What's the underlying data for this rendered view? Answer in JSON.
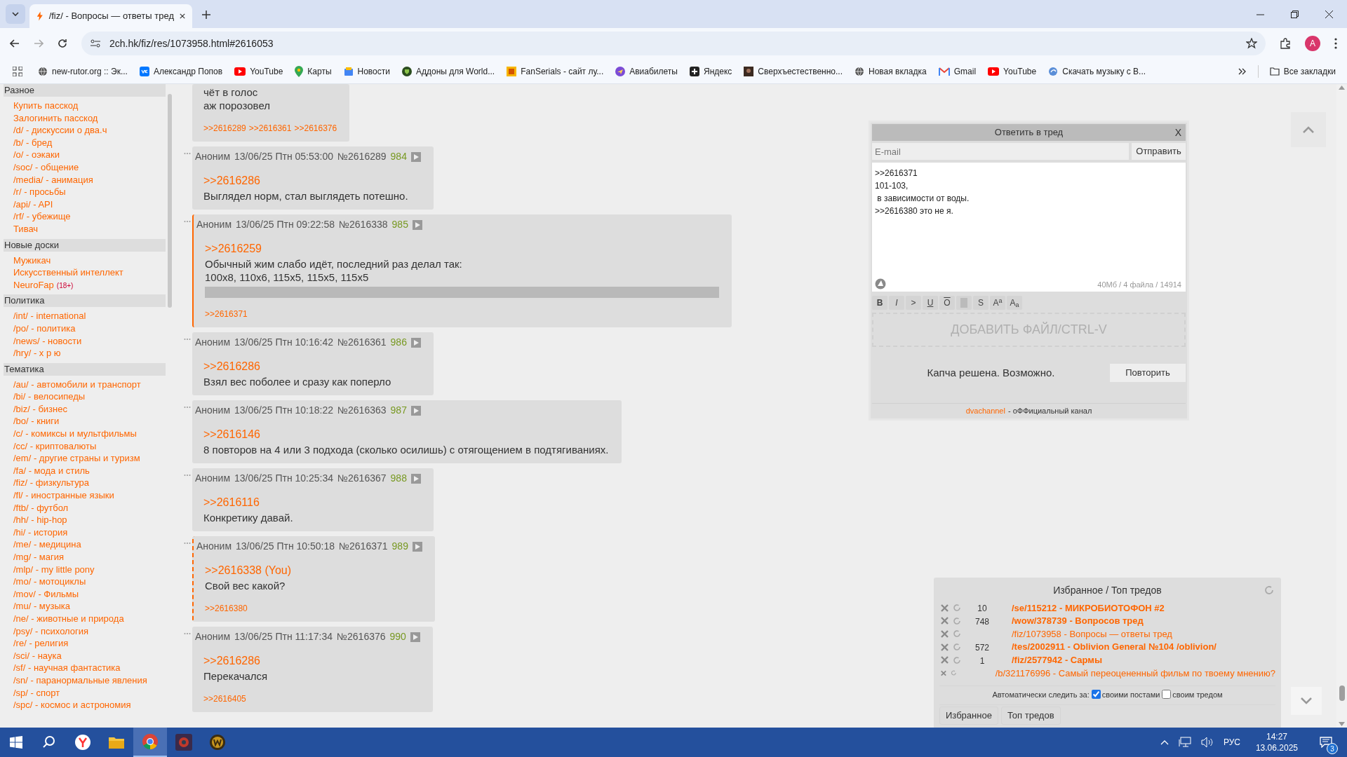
{
  "browser": {
    "tab_title": "/fiz/ - Вопросы — ответы тред",
    "url": "2ch.hk/fiz/res/1073958.html#2616053",
    "avatar": "A",
    "all_bookmarks": "Все закладки",
    "bookmarks": [
      {
        "label": "new-rutor.org :: Эк..."
      },
      {
        "label": "Александр Попов"
      },
      {
        "label": "YouTube"
      },
      {
        "label": "Карты"
      },
      {
        "label": "Новости"
      },
      {
        "label": "Аддоны для World..."
      },
      {
        "label": "FanSerials - сайт лу..."
      },
      {
        "label": "Авиабилеты"
      },
      {
        "label": "Яндекс"
      },
      {
        "label": "Сверхъестественно..."
      },
      {
        "label": "Новая вкладка"
      },
      {
        "label": "Gmail"
      },
      {
        "label": "YouTube"
      },
      {
        "label": "Скачать музыку с В..."
      }
    ]
  },
  "sidebar": {
    "sections": [
      {
        "heading": "Разное",
        "items": [
          {
            "label": "Купить пасскод"
          },
          {
            "label": "Залогинить пасскод"
          },
          {
            "label": "/d/ - дискуссии о два.ч"
          },
          {
            "label": "/b/ - бред"
          },
          {
            "label": "/o/ - оэкаки"
          },
          {
            "label": "/soc/ - общение"
          },
          {
            "label": "/media/ - анимация"
          },
          {
            "label": "/r/ - просьбы"
          },
          {
            "label": "/api/ - API"
          },
          {
            "label": "/rf/ - убежище"
          },
          {
            "label": "Тивач"
          }
        ]
      },
      {
        "heading": "Новые доски",
        "items": [
          {
            "label": "Мужикач"
          },
          {
            "label": "Искусственный интеллект"
          },
          {
            "label": "NeuroFap",
            "badge": "(18+)"
          }
        ]
      },
      {
        "heading": "Политика",
        "items": [
          {
            "label": "/int/ - international"
          },
          {
            "label": "/po/ - политика"
          },
          {
            "label": "/news/ - новости"
          },
          {
            "label": "/hry/ - х р ю"
          }
        ]
      },
      {
        "heading": "Тематика",
        "items": [
          {
            "label": "/au/ - автомобили и транспорт"
          },
          {
            "label": "/bi/ - велосипеды"
          },
          {
            "label": "/biz/ - бизнес"
          },
          {
            "label": "/bo/ - книги"
          },
          {
            "label": "/c/ - комиксы и мультфильмы"
          },
          {
            "label": "/cc/ - криптовалюты"
          },
          {
            "label": "/em/ - другие страны и туризм"
          },
          {
            "label": "/fa/ - мода и стиль"
          },
          {
            "label": "/fiz/ - физкультура"
          },
          {
            "label": "/fl/ - иностранные языки"
          },
          {
            "label": "/ftb/ - футбол"
          },
          {
            "label": "/hh/ - hip-hop"
          },
          {
            "label": "/hi/ - история"
          },
          {
            "label": "/me/ - медицина"
          },
          {
            "label": "/mg/ - магия"
          },
          {
            "label": "/mlp/ - my little pony"
          },
          {
            "label": "/mo/ - мотоциклы"
          },
          {
            "label": "/mov/ - Фильмы"
          },
          {
            "label": "/mu/ - музыка"
          },
          {
            "label": "/ne/ - животные и природа"
          },
          {
            "label": "/psy/ - психология"
          },
          {
            "label": "/re/ - религия"
          },
          {
            "label": "/sci/ - наука"
          },
          {
            "label": "/sf/ - научная фантастика"
          },
          {
            "label": "/sn/ - паранормальные явления"
          },
          {
            "label": "/sp/ - спорт"
          },
          {
            "label": "/spc/ - космос и астрономия"
          }
        ]
      }
    ]
  },
  "posts": [
    {
      "lines": [
        "чёт в голос",
        "аж порозовел"
      ],
      "replies": [
        ">>2616289",
        ">>2616361",
        ">>2616376"
      ],
      "highlighted": false,
      "replies_to_you": false,
      "spoiler": false
    },
    {
      "author": "Аноним",
      "date": "13/06/25 Птн 05:53:00",
      "number": "№2616289",
      "index": "984",
      "quote": ">>2616286",
      "lines": [
        "Выглядел норм, стал выглядеть потешно."
      ],
      "highlighted": false,
      "replies_to_you": false,
      "spoiler": false
    },
    {
      "author": "Аноним",
      "date": "13/06/25 Птн 09:22:58",
      "number": "№2616338",
      "index": "985",
      "quote": ">>2616259",
      "lines": [
        "Обычный жим слабо идёт, последний раз делал так:",
        "100x8, 110x6, 115x5, 115x5, 115x5"
      ],
      "replies": [
        ">>2616371"
      ],
      "highlighted": true,
      "replies_to_you": false,
      "spoiler": true
    },
    {
      "author": "Аноним",
      "date": "13/06/25 Птн 10:16:42",
      "number": "№2616361",
      "index": "986",
      "quote": ">>2616286",
      "lines": [
        "Взял вес поболее и сразу как поперло"
      ],
      "highlighted": false,
      "replies_to_you": false,
      "spoiler": false
    },
    {
      "author": "Аноним",
      "date": "13/06/25 Птн 10:18:22",
      "number": "№2616363",
      "index": "987",
      "quote": ">>2616146",
      "lines": [
        "8 повторов на 4 или 3 подхода (сколько осилишь) с отягощением в подтягиваниях."
      ],
      "highlighted": false,
      "replies_to_you": false,
      "spoiler": false
    },
    {
      "author": "Аноним",
      "date": "13/06/25 Птн 10:25:34",
      "number": "№2616367",
      "index": "988",
      "quote": ">>2616116",
      "lines": [
        "Конкретику давай."
      ],
      "highlighted": false,
      "replies_to_you": false,
      "spoiler": false
    },
    {
      "author": "Аноним",
      "date": "13/06/25 Птн 10:50:18",
      "number": "№2616371",
      "index": "989",
      "quote": ">>2616338 (You)",
      "lines": [
        "Свой вес какой?"
      ],
      "replies": [
        ">>2616380"
      ],
      "highlighted": false,
      "replies_to_you": true,
      "spoiler": false
    },
    {
      "author": "Аноним",
      "date": "13/06/25 Птн 11:17:34",
      "number": "№2616376",
      "index": "990",
      "quote": ">>2616286",
      "lines": [
        "Перекачался"
      ],
      "replies": [
        ">>2616405"
      ],
      "highlighted": false,
      "replies_to_you": false,
      "spoiler": false
    }
  ],
  "reply_form": {
    "title": "Ответить в тред",
    "close": "X",
    "email_placeholder": "E-mail",
    "send": "Отправить",
    "message": ">>2616371\n101-103,\n в зависимости от воды.\n>>2616380 это не я.",
    "limits": "40Мб / 4 файла / 14914",
    "format_buttons": [
      {
        "kind": "bold",
        "label": "B"
      },
      {
        "kind": "italic",
        "label": "I"
      },
      {
        "kind": "quote",
        "label": ">"
      },
      {
        "kind": "underline",
        "label": "U"
      },
      {
        "kind": "overline",
        "label": "O"
      },
      {
        "kind": "spoiler"
      },
      {
        "kind": "strike",
        "label": "S"
      },
      {
        "kind": "sup",
        "label": "A$^{a}$"
      },
      {
        "kind": "sub",
        "label": "A$_{a}$"
      }
    ],
    "dropzone": "ДОБАВИТЬ ФАЙЛ/CTRL-V",
    "captcha_status": "Капча решена. Возможно.",
    "retry": "Повторить",
    "channel_link": "dvachannel",
    "channel_text": "- оФФициальный канал"
  },
  "favorites": {
    "title": "Избранное / Топ тредов",
    "rows": [
      {
        "count": "10",
        "title": "/se/115212 - МИКРОБИОТОФОН #2",
        "bold": true
      },
      {
        "count": "748",
        "title": "/wow/378739 - Вопросов тред",
        "bold": true
      },
      {
        "title": "/fiz/1073958 - Вопросы — ответы тред",
        "bold": false
      },
      {
        "count": "572",
        "title": "/tes/2002911 - Oblivion General №104 /oblivion/",
        "bold": true
      },
      {
        "count": "1",
        "title": "/fiz/2577942 - Сармы",
        "bold": true
      },
      {
        "title": "/b/321176996 - Самый переоцененный фильм по твоему мнению?",
        "bold": false
      }
    ],
    "auto_follow": "Автоматически следить за:",
    "options": [
      {
        "label": "своими постами",
        "checked": true
      },
      {
        "label": "своим тредом",
        "checked": false
      }
    ],
    "tabs": [
      {
        "label": "Избранное"
      },
      {
        "label": "Топ тредов"
      }
    ]
  },
  "taskbar": {
    "apps": [
      {
        "kind": "search",
        "selected": false
      },
      {
        "kind": "yandex",
        "selected": false
      },
      {
        "kind": "files",
        "selected": false
      },
      {
        "kind": "chrome",
        "selected": true
      },
      {
        "kind": "game",
        "selected": false
      },
      {
        "kind": "wow",
        "selected": false
      }
    ],
    "language": "РУС",
    "time": "14:27",
    "date": "13.06.2025",
    "notifications": "3"
  }
}
